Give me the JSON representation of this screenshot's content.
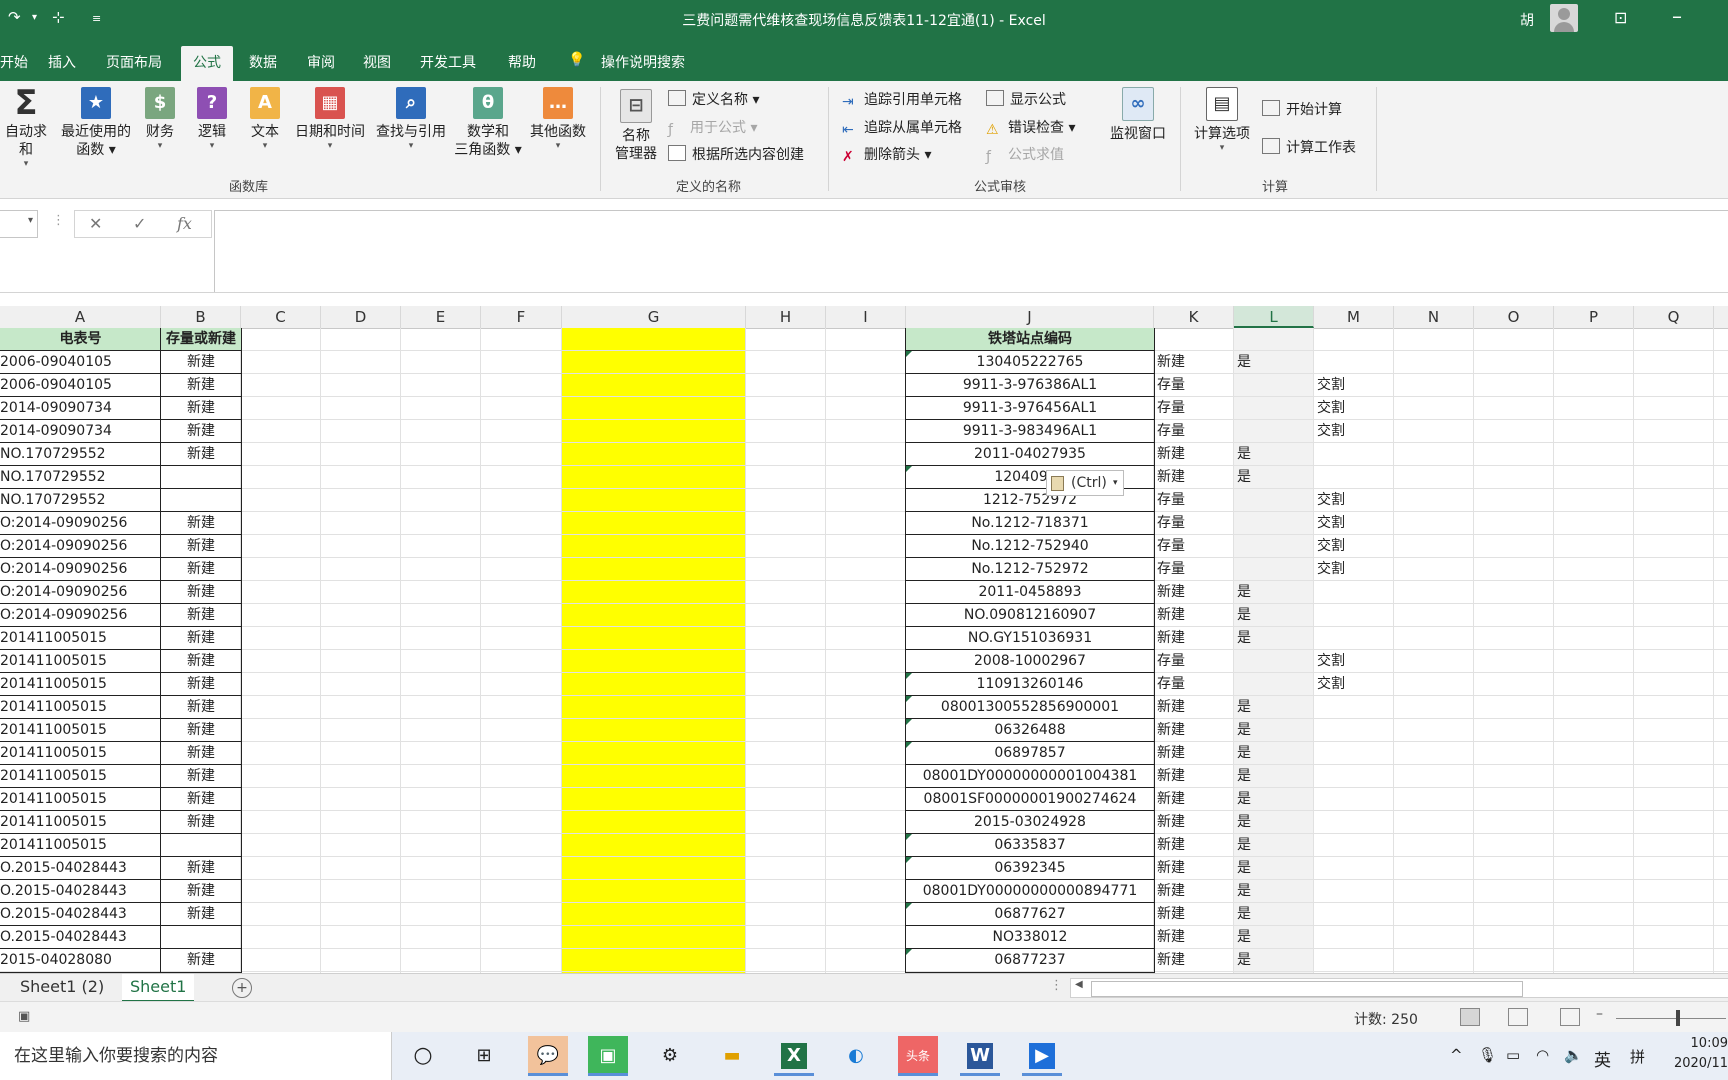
{
  "window": {
    "title": "三费问题需代维核查现场信息反馈表11-12宜通(1)  -  Excel",
    "user": "胡"
  },
  "menu_tabs": [
    "开始",
    "插入",
    "页面布局",
    "公式",
    "数据",
    "审阅",
    "视图",
    "开发工具",
    "帮助"
  ],
  "active_tab": "公式",
  "tell_me": "操作说明搜索",
  "ribbon": {
    "function_library": {
      "autosum": "自动求和",
      "recent": "最近使用的",
      "recent2": "函数",
      "financial": "财务",
      "logical": "逻辑",
      "text": "文本",
      "datetime": "日期和时间",
      "lookup": "查找与引用",
      "math": "数学和",
      "math2": "三角函数",
      "more": "其他函数",
      "group": "函数库"
    },
    "defined_names": {
      "manager": "名称",
      "manager2": "管理器",
      "define": "定义名称",
      "use": "用于公式",
      "create": "根据所选内容创建",
      "group": "定义的名称"
    },
    "auditing": {
      "trace_prec": "追踪引用单元格",
      "trace_dep": "追踪从属单元格",
      "remove": "删除箭头",
      "show": "显示公式",
      "check": "错误检查",
      "evaluate": "公式求值",
      "watch": "监视窗口",
      "group": "公式审核"
    },
    "calculation": {
      "options": "计算选项",
      "calc_now": "开始计算",
      "calc_sheet": "计算工作表",
      "group": "计算"
    }
  },
  "formula_bar": {
    "fx": "fx",
    "cancel": "✕",
    "enter": "✓"
  },
  "columns": [
    "A",
    "B",
    "C",
    "D",
    "E",
    "F",
    "G",
    "H",
    "I",
    "J",
    "K",
    "L",
    "M",
    "N",
    "O",
    "P",
    "Q"
  ],
  "selected_column": "L",
  "headers": {
    "A": "电表号",
    "B": "存量或新建",
    "J": "铁塔站点编码"
  },
  "rows": [
    {
      "a": "2006-09040105",
      "b": "新建",
      "j": "130405222765",
      "k": "新建",
      "l": "是",
      "m": "",
      "t": true
    },
    {
      "a": "2006-09040105",
      "b": "新建",
      "j": "9911-3-976386AL1",
      "k": "存量",
      "l": "",
      "m": "交割",
      "t": false
    },
    {
      "a": "2014-09090734",
      "b": "新建",
      "j": "9911-3-976456AL1",
      "k": "存量",
      "l": "",
      "m": "交割",
      "t": false
    },
    {
      "a": "2014-09090734",
      "b": "新建",
      "j": "9911-3-983496AL1",
      "k": "存量",
      "l": "",
      "m": "交割",
      "t": false
    },
    {
      "a": "NO.170729552",
      "b": "新建",
      "j": "2011-04027935",
      "k": "新建",
      "l": "是",
      "m": "",
      "t": false
    },
    {
      "a": "NO.170729552",
      "b": "",
      "j": "12040901",
      "k": "新建",
      "l": "是",
      "m": "",
      "t": true
    },
    {
      "a": "NO.170729552",
      "b": "",
      "j": "1212-752972",
      "k": "存量",
      "l": "",
      "m": "交割",
      "t": false
    },
    {
      "a": "O:2014-09090256",
      "b": "新建",
      "j": "No.1212-718371",
      "k": "存量",
      "l": "",
      "m": "交割",
      "t": false
    },
    {
      "a": "O:2014-09090256",
      "b": "新建",
      "j": "No.1212-752940",
      "k": "存量",
      "l": "",
      "m": "交割",
      "t": false
    },
    {
      "a": "O:2014-09090256",
      "b": "新建",
      "j": "No.1212-752972",
      "k": "存量",
      "l": "",
      "m": "交割",
      "t": false
    },
    {
      "a": "O:2014-09090256",
      "b": "新建",
      "j": "2011-0458893",
      "k": "新建",
      "l": "是",
      "m": "",
      "t": false
    },
    {
      "a": "O:2014-09090256",
      "b": "新建",
      "j": "NO.090812160907",
      "k": "新建",
      "l": "是",
      "m": "",
      "t": false
    },
    {
      "a": "201411005015",
      "b": "新建",
      "j": "NO.GY151036931",
      "k": "新建",
      "l": "是",
      "m": "",
      "t": false
    },
    {
      "a": "201411005015",
      "b": "新建",
      "j": "2008-10002967",
      "k": "存量",
      "l": "",
      "m": "交割",
      "t": false
    },
    {
      "a": "201411005015",
      "b": "新建",
      "j": "110913260146",
      "k": "存量",
      "l": "",
      "m": "交割",
      "t": true
    },
    {
      "a": "201411005015",
      "b": "新建",
      "j": "08001300552856900001",
      "k": "新建",
      "l": "是",
      "m": "",
      "t": true
    },
    {
      "a": "201411005015",
      "b": "新建",
      "j": "06326488",
      "k": "新建",
      "l": "是",
      "m": "",
      "t": true
    },
    {
      "a": "201411005015",
      "b": "新建",
      "j": "06897857",
      "k": "新建",
      "l": "是",
      "m": "",
      "t": true
    },
    {
      "a": "201411005015",
      "b": "新建",
      "j": "08001DY00000000001004381",
      "k": "新建",
      "l": "是",
      "m": "",
      "t": false
    },
    {
      "a": "201411005015",
      "b": "新建",
      "j": "08001SF00000001900274624",
      "k": "新建",
      "l": "是",
      "m": "",
      "t": false
    },
    {
      "a": "201411005015",
      "b": "新建",
      "j": "2015-03024928",
      "k": "新建",
      "l": "是",
      "m": "",
      "t": false
    },
    {
      "a": "201411005015",
      "b": "",
      "j": "06335837",
      "k": "新建",
      "l": "是",
      "m": "",
      "t": true
    },
    {
      "a": "O.2015-04028443",
      "b": "新建",
      "j": "06392345",
      "k": "新建",
      "l": "是",
      "m": "",
      "t": true
    },
    {
      "a": "O.2015-04028443",
      "b": "新建",
      "j": "08001DY00000000000894771",
      "k": "新建",
      "l": "是",
      "m": "",
      "t": false
    },
    {
      "a": "O.2015-04028443",
      "b": "新建",
      "j": "06877627",
      "k": "新建",
      "l": "是",
      "m": "",
      "t": true
    },
    {
      "a": "O.2015-04028443",
      "b": "",
      "j": "NO338012",
      "k": "新建",
      "l": "是",
      "m": "",
      "t": false
    },
    {
      "a": "2015-04028080",
      "b": "新建",
      "j": "06877237",
      "k": "新建",
      "l": "是",
      "m": "",
      "t": true
    }
  ],
  "paste_options": "(Ctrl)",
  "sheets": [
    "Sheet1 (2)",
    "Sheet1"
  ],
  "active_sheet": "Sheet1",
  "status": {
    "count": "计数: 250"
  },
  "taskbar": {
    "search_placeholder": "在这里输入你要搜索的内容",
    "ime1": "英",
    "ime2": "拼",
    "time": "10:09",
    "date": "2020/11"
  },
  "colors": {
    "excel_green": "#217346",
    "highlight_yellow": "#ffff00",
    "header_green": "#c6e8c9"
  }
}
